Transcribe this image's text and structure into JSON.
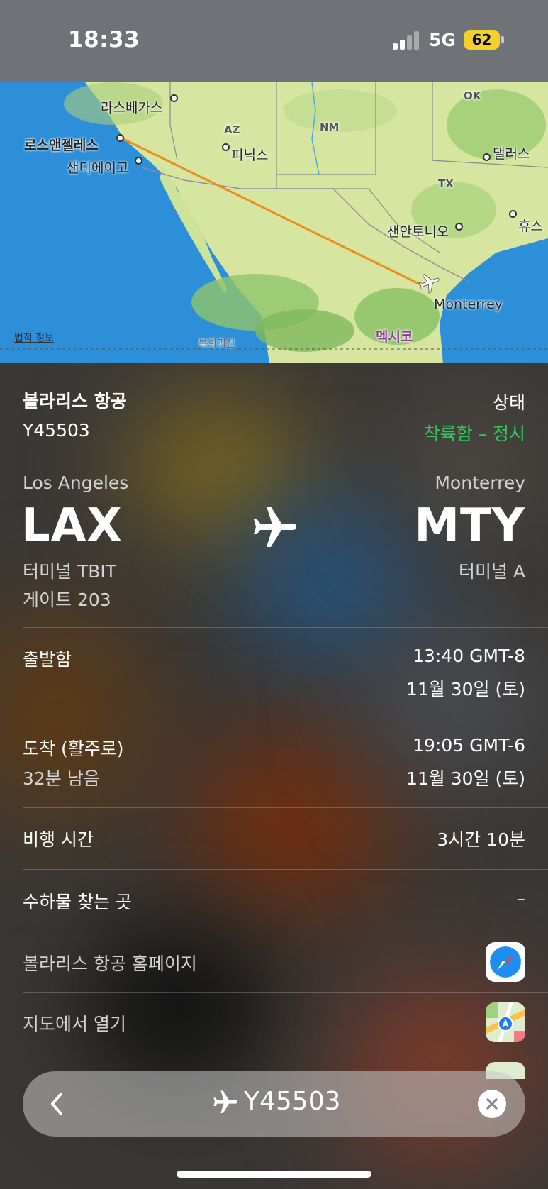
{
  "status_bar": {
    "time": "18:33",
    "network": "5G",
    "battery": "62"
  },
  "map": {
    "labels": {
      "las_vegas": "라스베가스",
      "los_angeles": "로스앤젤레스",
      "san_diego": "샌디에이고",
      "az": "AZ",
      "phoenix": "피닉스",
      "nm": "NM",
      "ok": "OK",
      "dallas": "댈러스",
      "tx": "TX",
      "san_antonio": "샌안토니오",
      "houston": "휴스",
      "monterrey": "Monterrey",
      "mexico": "멕시코",
      "tropic": "북회귀선"
    },
    "legal_link": "법적 정보"
  },
  "flight": {
    "airline": "볼라리스 항공",
    "number": "Y45503",
    "status_label": "상태",
    "status_value": "착륙함 – 정시",
    "origin": {
      "city": "Los Angeles",
      "code": "LAX",
      "terminal": "터미널 TBIT",
      "gate": "게이트 203"
    },
    "destination": {
      "city": "Monterrey",
      "code": "MTY",
      "terminal": "터미널 A"
    }
  },
  "details": {
    "departed_label": "출발함",
    "departed_time": "13:40 GMT-8",
    "departed_date": "11월 30일 (토)",
    "arrival_label": "도착 (활주로)",
    "arrival_remaining": "32분 남음",
    "arrival_time": "19:05 GMT-6",
    "arrival_date": "11월 30일 (토)",
    "duration_label": "비행 시간",
    "duration_value": "3시간 10분",
    "baggage_label": "수하물 찾는 곳",
    "baggage_value": "–"
  },
  "links": {
    "homepage": "볼라리스 항공 홈페이지",
    "maps": "지도에서 열기"
  },
  "search": {
    "query": "Y45503"
  },
  "colors": {
    "status_green": "#33c759",
    "route_orange": "#f08a1c",
    "battery_yellow": "#f2d12c"
  }
}
